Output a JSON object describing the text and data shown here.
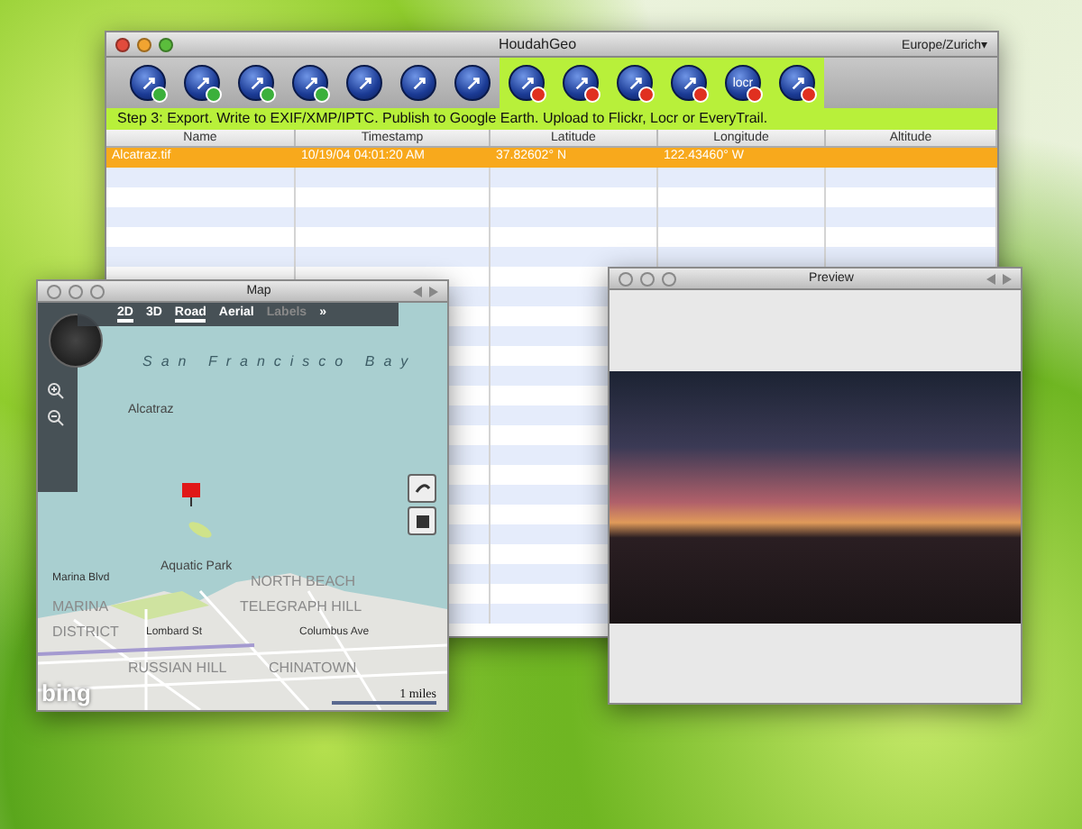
{
  "main_window": {
    "title": "HoudahGeo",
    "timezone": "Europe/Zurich▾",
    "toolbar": [
      {
        "kind": "add",
        "highlighted": false
      },
      {
        "kind": "add",
        "highlighted": false
      },
      {
        "kind": "add",
        "highlighted": false
      },
      {
        "kind": "add",
        "highlighted": false
      },
      {
        "kind": "plain",
        "highlighted": false
      },
      {
        "kind": "plain",
        "highlighted": false
      },
      {
        "kind": "plain",
        "highlighted": false
      },
      {
        "kind": "remove",
        "highlighted": true
      },
      {
        "kind": "remove",
        "highlighted": true
      },
      {
        "kind": "remove",
        "highlighted": true
      },
      {
        "kind": "remove",
        "highlighted": true
      },
      {
        "kind": "remove",
        "highlighted": true,
        "label": "locr"
      },
      {
        "kind": "remove",
        "highlighted": true
      }
    ],
    "step_text": "Step 3: Export. Write to EXIF/XMP/IPTC. Publish to Google Earth. Upload to Flickr, Locr or EveryTrail.",
    "table": {
      "columns": [
        "Name",
        "Timestamp",
        "Latitude",
        "Longitude",
        "Altitude"
      ],
      "rows": [
        {
          "selected": true,
          "cells": [
            "Alcatraz.tif",
            "10/19/04 04:01:20 AM",
            "37.82602° N",
            "122.43460° W",
            ""
          ]
        }
      ]
    }
  },
  "map_window": {
    "title": "Map",
    "modes": [
      {
        "label": "2D",
        "selected": true,
        "disabled": false
      },
      {
        "label": "3D",
        "selected": false,
        "disabled": false
      },
      {
        "label": "Road",
        "selected": true,
        "disabled": false
      },
      {
        "label": "Aerial",
        "selected": false,
        "disabled": false
      },
      {
        "label": "Labels",
        "selected": false,
        "disabled": true
      },
      {
        "label": "»",
        "selected": false,
        "disabled": false
      }
    ],
    "labels": [
      {
        "text": "San Francisco Bay",
        "kind": "water"
      },
      {
        "text": "Alcatraz",
        "kind": "place"
      },
      {
        "text": "Marina Blvd",
        "kind": "street"
      },
      {
        "text": "Aquatic Park",
        "kind": "place"
      },
      {
        "text": "MARINA",
        "kind": "district"
      },
      {
        "text": "DISTRICT",
        "kind": "district"
      },
      {
        "text": "NORTH BEACH",
        "kind": "district"
      },
      {
        "text": "TELEGRAPH HILL",
        "kind": "district"
      },
      {
        "text": "Lombard St",
        "kind": "street"
      },
      {
        "text": "Columbus Ave",
        "kind": "street"
      },
      {
        "text": "RUSSIAN HILL",
        "kind": "district"
      },
      {
        "text": "CHINATOWN",
        "kind": "district"
      }
    ],
    "scale": "1 miles",
    "logo": "bing"
  },
  "preview_window": {
    "title": "Preview"
  }
}
